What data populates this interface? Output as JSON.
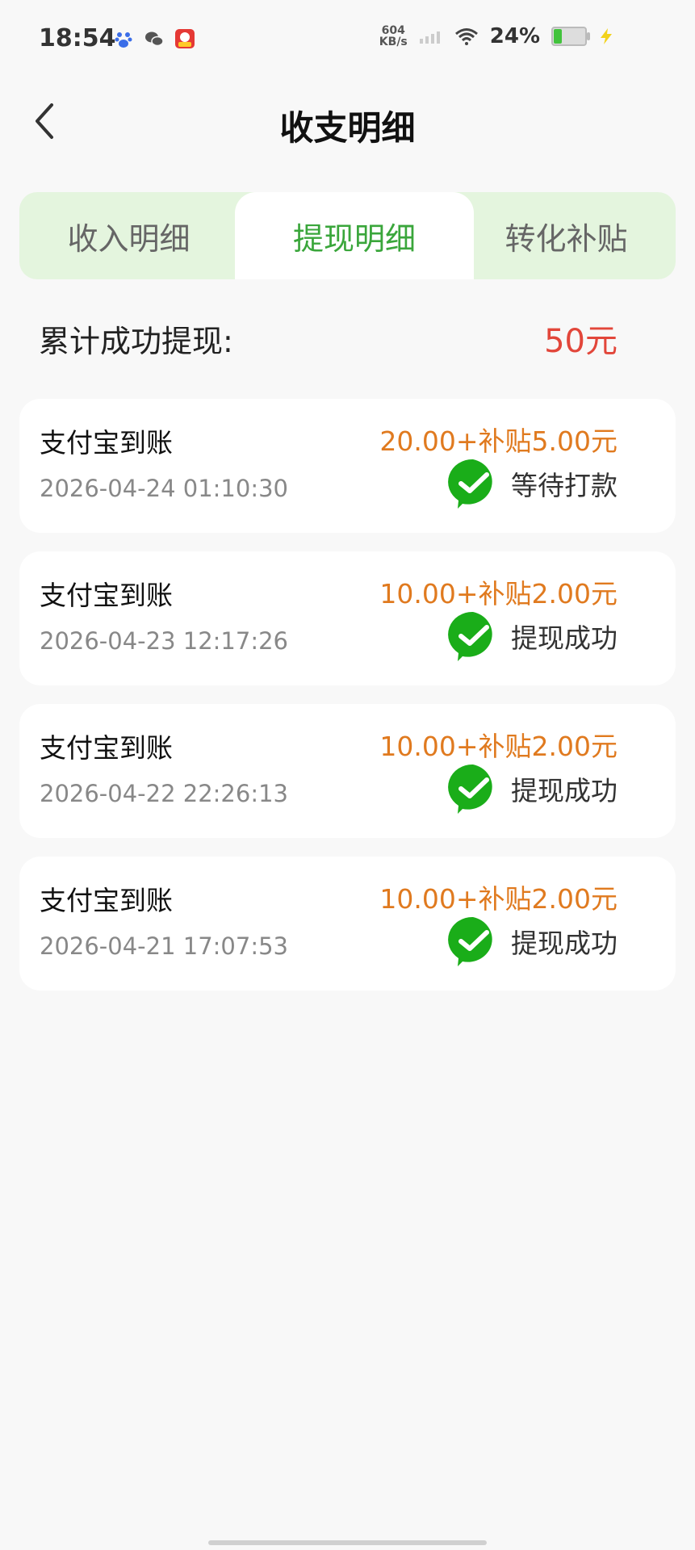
{
  "status_bar": {
    "time": "18:54",
    "net_speed_value": "604",
    "net_speed_unit": "KB/s",
    "battery_percent": "24%",
    "app_icons": [
      "baidu-icon",
      "wechat-icon",
      "game-app-icon"
    ],
    "colors": {
      "battery_fill": "#42c33c"
    }
  },
  "nav": {
    "title": "收支明细",
    "back_icon": "chevron-left-icon"
  },
  "tabs": [
    {
      "label": "收入明细",
      "active": false
    },
    {
      "label": "提现明细",
      "active": true
    },
    {
      "label": "转化补贴",
      "active": false
    }
  ],
  "summary": {
    "label": "累计成功提现:",
    "value": "50元"
  },
  "records": [
    {
      "title": "支付宝到账",
      "time": "2026-04-24 01:10:30",
      "amount": "20.00+补贴5.00元",
      "status": "等待打款"
    },
    {
      "title": "支付宝到账",
      "time": "2026-04-23 12:17:26",
      "amount": "10.00+补贴2.00元",
      "status": "提现成功"
    },
    {
      "title": "支付宝到账",
      "time": "2026-04-22 22:26:13",
      "amount": "10.00+补贴2.00元",
      "status": "提现成功"
    },
    {
      "title": "支付宝到账",
      "time": "2026-04-21 17:07:53",
      "amount": "10.00+补贴2.00元",
      "status": "提现成功"
    }
  ],
  "colors": {
    "accent_green": "#3aa63b",
    "tab_bg": "#e4f5de",
    "amount_orange": "#e07a1f",
    "summary_red": "#e2463a",
    "check_green": "#1aad19"
  }
}
